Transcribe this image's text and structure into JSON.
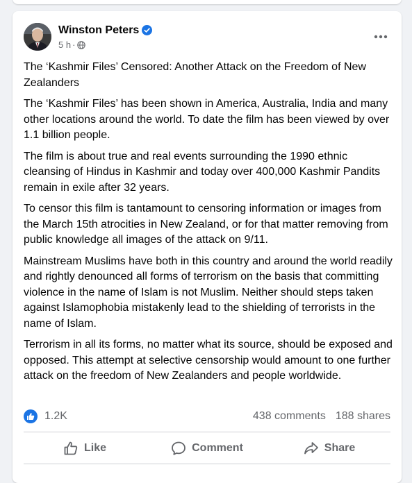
{
  "post": {
    "author": "Winston Peters",
    "timestamp": "5 h",
    "separator": "·",
    "verified_icon": "verified-badge-icon",
    "privacy_icon": "globe-icon",
    "more_icon": "more-options-icon",
    "paragraphs": [
      "The ‘Kashmir Files’ Censored: Another Attack on the Freedom of New Zealanders",
      "The ‘Kashmir Files’ has been shown in America, Australia, India and many other locations around the world.  To date the film has been viewed by over 1.1 billion people.",
      "The film is about true and real events surrounding the 1990 ethnic cleansing of Hindus in Kashmir and today over 400,000 Kashmir Pandits remain in exile after 32 years.",
      "To censor this film is tantamount to censoring information or images from the March 15th atrocities in New Zealand, or for that matter removing from public knowledge all images of the attack on 9/11.",
      "Mainstream Muslims have both in this country and around the world readily and rightly denounced all forms of terrorism on the basis that committing violence in the name of Islam is not Muslim.  Neither should steps taken against Islamophobia mistakenly lead to the shielding of terrorists in the name of Islam.",
      "Terrorism in all its forms, no matter what its source, should be exposed and opposed.  This attempt at selective censorship would amount to one further attack on the freedom of New Zealanders and people worldwide."
    ]
  },
  "stats": {
    "reactions": "1.2K",
    "comments": "438 comments",
    "shares": "188 shares"
  },
  "actions": {
    "like": "Like",
    "comment": "Comment",
    "share": "Share"
  },
  "colors": {
    "accent": "#1b74e4",
    "secondary_text": "#65676b",
    "background": "#f0f2f5"
  }
}
